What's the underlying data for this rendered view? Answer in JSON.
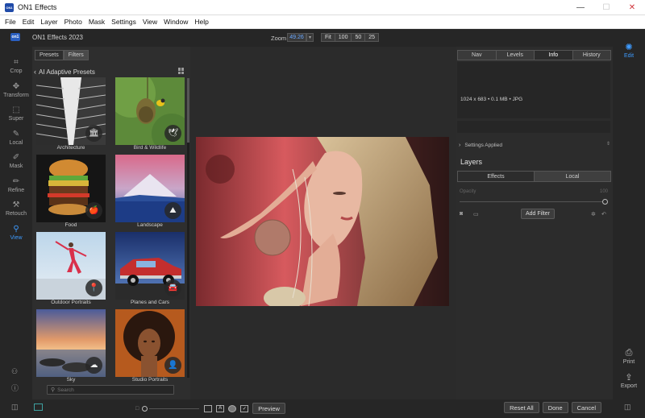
{
  "window": {
    "title": "ON1 Effects",
    "logo_text": "ON1",
    "controls": [
      "—",
      "☐",
      "✕"
    ]
  },
  "menu": [
    "File",
    "Edit",
    "Layer",
    "Photo",
    "Mask",
    "Settings",
    "View",
    "Window",
    "Help"
  ],
  "toolbar": {
    "app_name": "ON1 Effects 2023",
    "logo_text": "on1",
    "zoom_label": "Zoom",
    "zoom_value": "49.26",
    "zoom_presets": [
      "Fit",
      "100",
      "50",
      "25"
    ]
  },
  "tools": [
    {
      "name": "crop",
      "label": "Crop",
      "icon": "⌗"
    },
    {
      "name": "transform",
      "label": "Transform",
      "icon": "✥"
    },
    {
      "name": "super",
      "label": "Super",
      "icon": "⬚"
    },
    {
      "name": "local",
      "label": "Local",
      "icon": "✎"
    },
    {
      "name": "mask",
      "label": "Mask",
      "icon": "✐"
    },
    {
      "name": "refine",
      "label": "Refine",
      "icon": "✏"
    },
    {
      "name": "retouch",
      "label": "Retouch",
      "icon": "⚒"
    },
    {
      "name": "view",
      "label": "View",
      "icon": "⚲",
      "active": true
    }
  ],
  "browser": {
    "tabs": [
      {
        "label": "Presets",
        "active": false
      },
      {
        "label": "Filters",
        "active": true
      }
    ],
    "back_icon": "‹",
    "title": "AI Adaptive Presets",
    "thumbnails": [
      {
        "label": "Architecture",
        "badge": "🏛"
      },
      {
        "label": "Bird & Wildlife",
        "badge": "🕊"
      },
      {
        "label": "Food",
        "badge": "🍎"
      },
      {
        "label": "Landscape",
        "badge": "⛰"
      },
      {
        "label": "Outdoor Portraits",
        "badge": "📍"
      },
      {
        "label": "Planes and Cars",
        "badge": "🚘"
      },
      {
        "label": "Sky",
        "badge": "☁"
      },
      {
        "label": "Studio Portraits",
        "badge": "👤"
      }
    ],
    "search_placeholder": "Search"
  },
  "right_panel": {
    "tabs": [
      {
        "label": "Nav",
        "active": false
      },
      {
        "label": "Levels",
        "active": false
      },
      {
        "label": "Info",
        "active": true
      },
      {
        "label": "History",
        "active": false
      }
    ],
    "info_text": "1024 x 683 • 0.1 MB • JPG",
    "settings_applied": "Settings Applied",
    "layers_title": "Layers",
    "layer_tabs": [
      {
        "label": "Effects",
        "active": false
      },
      {
        "label": "Local",
        "active": true
      }
    ],
    "opacity_label": "Opacity",
    "opacity_value": "100",
    "opacity_fraction": 1.0,
    "add_filter": "Add Filter"
  },
  "right_strip": [
    {
      "label": "Edit",
      "icon": "✺",
      "active": true
    },
    {
      "label": "Print",
      "icon": "⎙",
      "active": false
    },
    {
      "label": "Export",
      "icon": "⇪",
      "active": false
    }
  ],
  "bottom": {
    "preview": "Preview",
    "reset_all": "Reset All",
    "done": "Done",
    "cancel": "Cancel"
  },
  "colors": {
    "accent": "#3e9bff",
    "panel": "#2c2c2c",
    "background": "#2b2b2b"
  }
}
